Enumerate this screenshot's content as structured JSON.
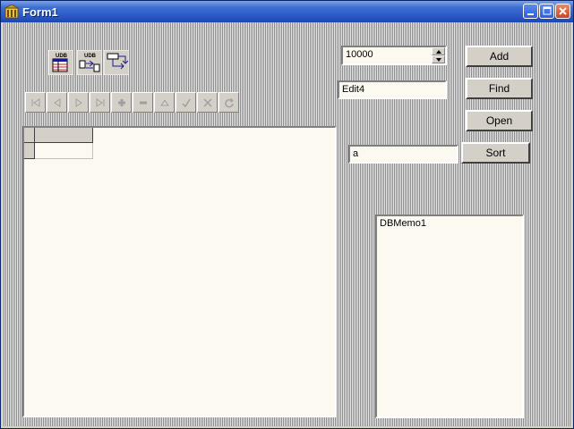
{
  "window": {
    "title": "Form1"
  },
  "spin": {
    "value": "10000"
  },
  "edits": {
    "edit4": "Edit4",
    "sort_field": "a"
  },
  "buttons": {
    "add": "Add",
    "find": "Find",
    "open": "Open",
    "sort": "Sort"
  },
  "memo": {
    "text": "DBMemo1"
  },
  "components": [
    {
      "name": "udb-table-icon",
      "label": "UDB"
    },
    {
      "name": "udb-datasource-icon",
      "label": "UDB"
    },
    {
      "name": "flow-icon",
      "label": ""
    }
  ],
  "navigator": [
    "first",
    "prior",
    "next",
    "last",
    "insert",
    "delete",
    "edit",
    "post",
    "cancel",
    "refresh"
  ],
  "colors": {
    "titlebar": "#2a59c6",
    "field_bg": "#fcfaf0",
    "face": "#d4d0c8"
  }
}
